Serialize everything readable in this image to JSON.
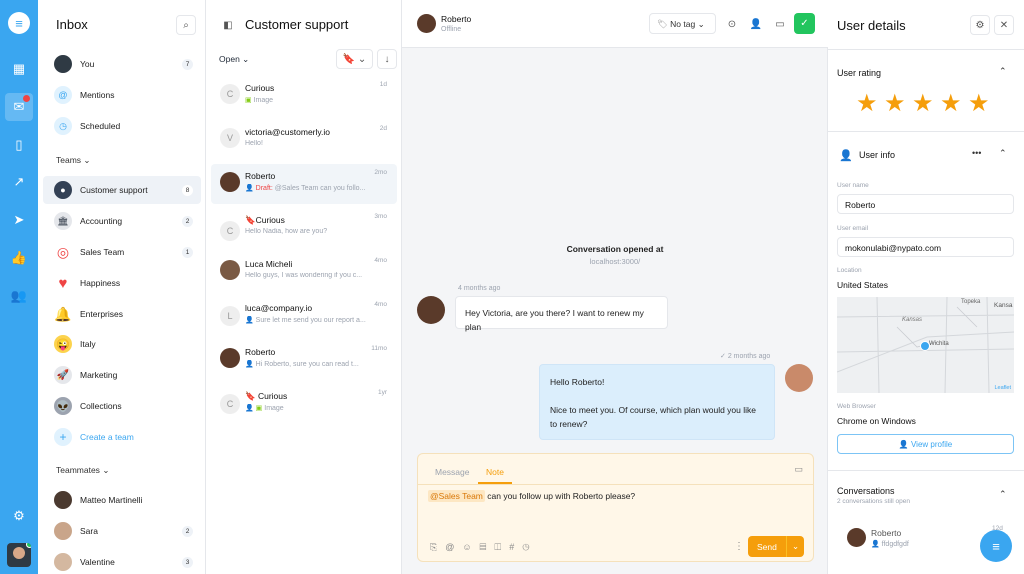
{
  "rail": {
    "logo": "customerly-logo",
    "badge": "1"
  },
  "inbox": {
    "title": "Inbox",
    "personal": [
      {
        "label": "You",
        "count": "7"
      },
      {
        "label": "Mentions"
      },
      {
        "label": "Scheduled"
      }
    ],
    "teams_label": "Teams",
    "teams": [
      {
        "label": "Customer support",
        "count": "8"
      },
      {
        "label": "Accounting",
        "count": "2"
      },
      {
        "label": "Sales Team",
        "count": "1"
      },
      {
        "label": "Happiness"
      },
      {
        "label": "Enterprises"
      },
      {
        "label": "Italy"
      },
      {
        "label": "Marketing"
      },
      {
        "label": "Collections"
      }
    ],
    "create_team": "Create a team",
    "teammates_label": "Teammates",
    "teammates": [
      {
        "label": "Matteo Martinelli"
      },
      {
        "label": "Sara",
        "count": "2"
      },
      {
        "label": "Valentine",
        "count": "3"
      }
    ]
  },
  "list": {
    "title": "Customer support",
    "filter": "Open",
    "items": [
      {
        "initial": "C",
        "name": "Curious",
        "preview": "Image",
        "time": "1d"
      },
      {
        "initial": "V",
        "name": "victoria@customerly.io",
        "preview": "Hello!",
        "time": "2d"
      },
      {
        "initial": "",
        "name": "Roberto",
        "draft": "Draft:",
        "preview": "@Sales Team can you follo...",
        "time": "2mo"
      },
      {
        "initial": "C",
        "name": "Curious",
        "preview": "Hello Nadia, how are you?",
        "time": "3mo"
      },
      {
        "initial": "",
        "name": "Luca Micheli",
        "preview": "Hello guys, I was wondering if you c...",
        "time": "4mo"
      },
      {
        "initial": "L",
        "name": "luca@company.io",
        "preview": "Sure let me send you our report a...",
        "time": "4mo"
      },
      {
        "initial": "",
        "name": "Roberto",
        "preview": "Hi Roberto, sure you can read t...",
        "time": "11mo"
      },
      {
        "initial": "C",
        "name": "Curious",
        "preview": "Image",
        "time": "1yr"
      }
    ]
  },
  "chat": {
    "name": "Roberto",
    "status": "Offline",
    "tag": "No tag",
    "opened_title": "Conversation opened at",
    "opened_url": "localhost:3000/",
    "msg1_time": "4 months ago",
    "msg1": "Hey Victoria, are you there? I want to renew my plan",
    "msg2_time": "2 months ago",
    "msg2_a": "Hello Roberto!",
    "msg2_b": "Nice to meet you. Of course, which plan would you like to renew?",
    "tab_message": "Message",
    "tab_note": "Note",
    "mention": "@Sales Team",
    "note_text": "can you follow up with Roberto please?",
    "send": "Send"
  },
  "details": {
    "title": "User details",
    "rating_label": "User rating",
    "rating": 5,
    "info_label": "User info",
    "name_label": "User name",
    "name": "Roberto",
    "email_label": "User email",
    "email": "mokonulabi@nypato.com",
    "location_label": "Location",
    "location": "United States",
    "map_labels": [
      "Topeka",
      "Kansa",
      "Kansas",
      "Wichita"
    ],
    "map_credit": "Leaflet",
    "browser_label": "Web Browser",
    "browser": "Chrome on Windows",
    "view_profile": "View profile",
    "conv_label": "Conversations",
    "conv_sub": "2 conversations still open",
    "conv_item_name": "Roberto",
    "conv_item_preview": "ffdgdfgdf",
    "conv_item_time": "12d"
  },
  "colors": {
    "accent": "#3aa6f0",
    "send": "#f59e0b",
    "success": "#22c55e"
  }
}
